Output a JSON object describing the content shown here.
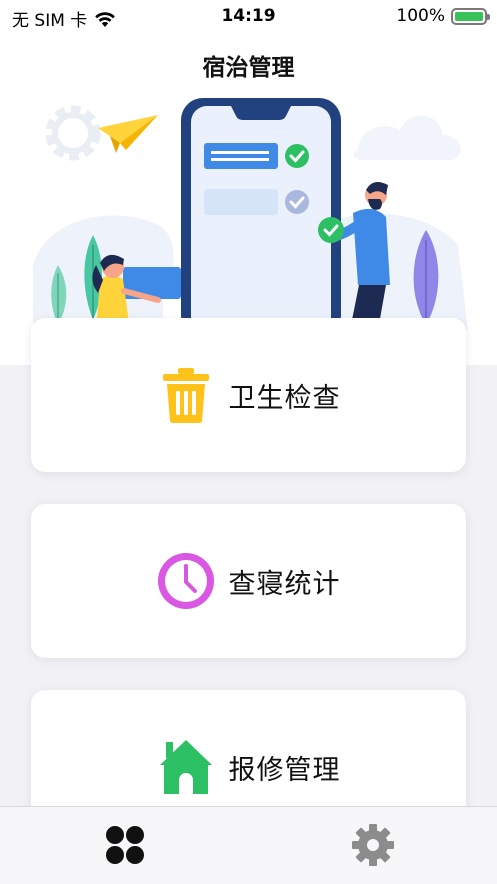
{
  "status_bar": {
    "carrier": "无 SIM 卡",
    "time": "14:19",
    "battery": "100%",
    "battery_level": 1.0,
    "wifi_icon": "wifi-icon",
    "battery_icon": "battery-icon"
  },
  "header": {
    "title": "宿治管理"
  },
  "menu": [
    {
      "label": "卫生检查",
      "icon": "trash-can-icon",
      "color": "#ffc21a"
    },
    {
      "label": "查寝统计",
      "icon": "clock-icon",
      "color": "#d957e3"
    },
    {
      "label": "报修管理",
      "icon": "house-icon",
      "color": "#2dbf63"
    }
  ],
  "tab_bar": {
    "items": [
      {
        "icon": "four-dots-grid-icon",
        "active": true,
        "color": "#111111"
      },
      {
        "icon": "gear-icon",
        "active": false,
        "color": "#888888"
      }
    ]
  },
  "colors": {
    "background": "#f1f1f6",
    "card": "#ffffff",
    "phone_frame": "#22417f",
    "accent_blue": "#3e8ae6",
    "check_green": "#2dbf63"
  }
}
